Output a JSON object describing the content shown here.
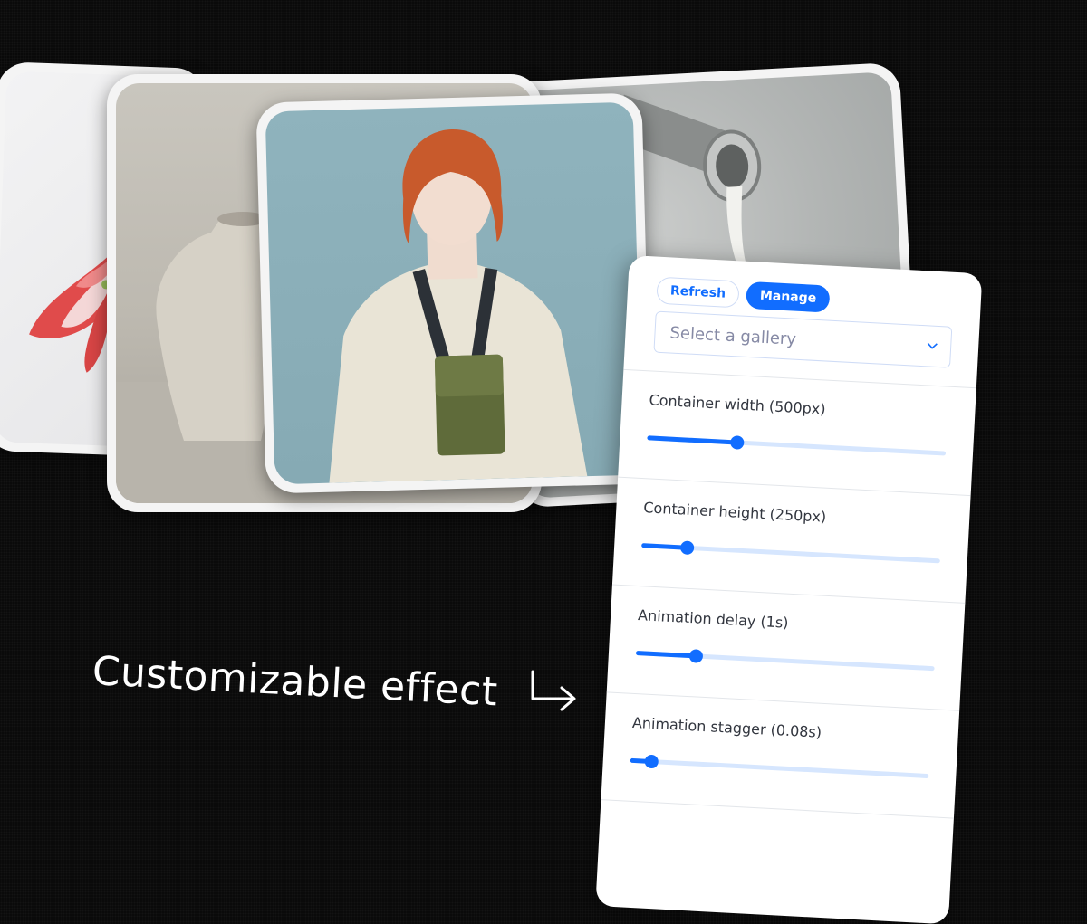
{
  "gallery_cards": [
    {
      "id": "flower",
      "subject": "red and white flower on light background"
    },
    {
      "id": "vase",
      "subject": "textured stone vase"
    },
    {
      "id": "person",
      "subject": "red-haired model in white jacket with green pouch"
    },
    {
      "id": "paint",
      "subject": "paint pouring from metal can"
    }
  ],
  "panel": {
    "buttons": {
      "refresh": "Refresh",
      "manage": "Manage"
    },
    "select": {
      "placeholder": "Select a gallery"
    },
    "settings": [
      {
        "label": "Container width (500px)",
        "level": 0.3
      },
      {
        "label": "Container height (250px)",
        "level": 0.15
      },
      {
        "label": "Animation delay (1s)",
        "level": 0.2
      },
      {
        "label": "Animation stagger (0.08s)",
        "level": 0.07
      }
    ]
  },
  "caption": "Customizable effect",
  "icons": {
    "caption_arrow": "arrow-turn-down-right-icon",
    "select_chevron": "chevron-down-icon"
  },
  "colors": {
    "accent": "#116dff",
    "track": "#d6e6fe",
    "background": "#0a0a0a"
  }
}
